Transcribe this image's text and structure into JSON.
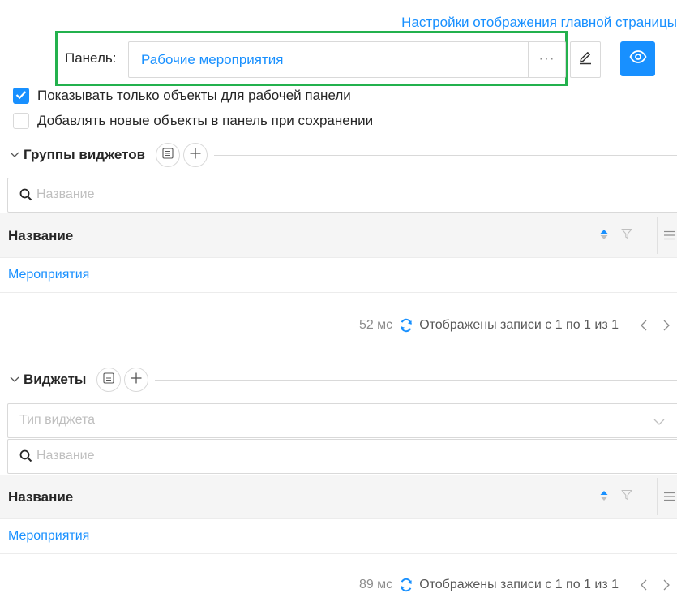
{
  "header": {
    "settings_link": "Настройки отображения главной страницы"
  },
  "panel": {
    "label": "Панель:",
    "value": "Рабочие мероприятия",
    "more_label": "···"
  },
  "options": {
    "show_only_label": "Показывать только объекты для рабочей панели",
    "show_only_checked": true,
    "add_new_label": "Добавлять новые объекты в панель при сохранении",
    "add_new_checked": false
  },
  "widget_groups": {
    "title": "Группы виджетов",
    "search_placeholder": "Название",
    "column_header": "Название",
    "rows": [
      "Мероприятия"
    ],
    "footer": {
      "timing": "52 мс",
      "records": "Отображены записи с 1 по 1 из 1"
    }
  },
  "widgets": {
    "title": "Виджеты",
    "type_placeholder": "Тип виджета",
    "search_placeholder": "Название",
    "column_header": "Название",
    "rows": [
      "Мероприятия"
    ],
    "footer": {
      "timing": "89 мс",
      "records": "Отображены записи с 1 по 1 из 1"
    }
  },
  "colors": {
    "accent": "#1890ff",
    "highlight_frame": "#23b14d",
    "border": "#d9d9d9",
    "header_bg": "#f5f5f5"
  },
  "icons": [
    "pencil-icon",
    "eye-icon",
    "check-icon",
    "chevron-down-icon",
    "list-icon",
    "plus-icon",
    "search-icon",
    "sort-icon",
    "filter-icon",
    "columns-icon",
    "refresh-icon",
    "chevron-left-icon",
    "chevron-right-icon"
  ]
}
